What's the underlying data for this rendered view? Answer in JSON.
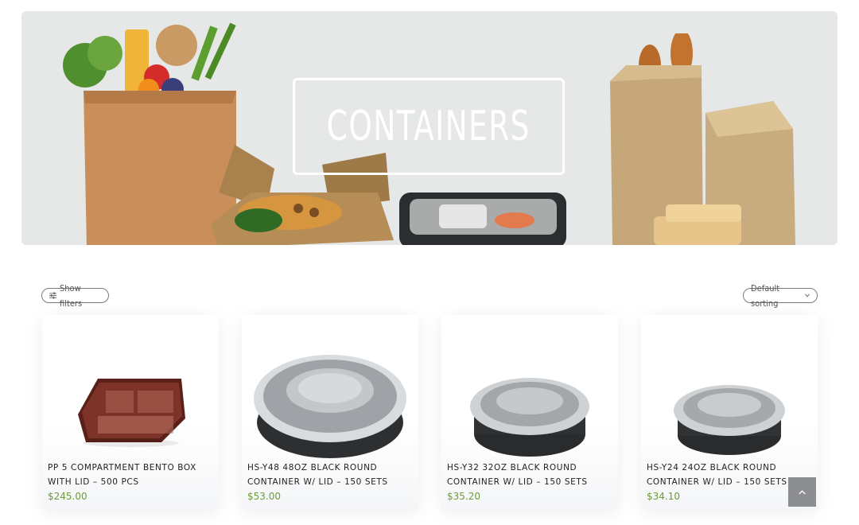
{
  "hero": {
    "title": "CONTAINERS"
  },
  "toolbar": {
    "show_filters_label": "Show filters",
    "sorting_label": "Default sorting",
    "filter_icon": "sliders-icon",
    "sorting_icon": "chevron-down-icon"
  },
  "products": [
    {
      "name": "PP 5 COMPARTMENT BENTO BOX WITH LID – 500 PCS",
      "price": "$245.00"
    },
    {
      "name": "HS-Y48 48OZ BLACK ROUND CONTAINER W/ LID – 150 SETS",
      "price": "$53.00"
    },
    {
      "name": "HS-Y32 32OZ BLACK ROUND CONTAINER W/ LID – 150 SETS",
      "price": "$35.20"
    },
    {
      "name": "HS-Y24 24OZ BLACK ROUND CONTAINER W/ LID – 150 SETS",
      "price": "$34.10"
    }
  ],
  "back_to_top": {
    "icon": "chevron-up-icon"
  },
  "colors": {
    "price": "#6d9b3b",
    "hero_bg": "#e6e8e8",
    "to_top_bg": "#8c8e91"
  }
}
